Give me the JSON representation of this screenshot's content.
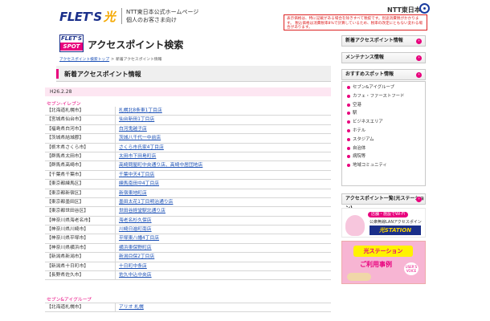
{
  "header": {
    "logo_text": "FLET'S",
    "logo_hikari": "光",
    "official_line1": "NTT東日本公式ホームページ",
    "official_line2": "個人のお客さま向け",
    "brand": "NTT東日本",
    "tax_notice": "表示価格は、特に記載がある場合を除きすべて税抜です。別途消費税がかかります。 税込価格は消費税率8%で計算しているため、税率の改定にともない変わる場合があります。"
  },
  "page": {
    "spot_logo_top": "FLET'S",
    "spot_logo_bottom": "SPOT",
    "title": "アクセスポイント検索",
    "breadcrumb": {
      "link": "アクセスポイント検索トップ",
      "sep": ">",
      "current": "新着アクセスポイント情報"
    }
  },
  "section": {
    "heading": "新着アクセスポイント情報",
    "date": "H26.2.28",
    "group1": "セブン-イレブン",
    "rows": [
      {
        "pref": "【北海道札幌市】",
        "loc": "札幌北8条東1丁目店"
      },
      {
        "pref": "【宮城県仙台市】",
        "loc": "仙台新田1丁目店"
      },
      {
        "pref": "【福島県白河市】",
        "loc": "白河鬼越子店"
      },
      {
        "pref": "【茨城県結城郡】",
        "loc": "茨城八千代一中前店"
      },
      {
        "pref": "【栃木県さくら市】",
        "loc": "さくら市氏家4丁目店"
      },
      {
        "pref": "【群馬県太田市】",
        "loc": "太田市下田島町店"
      },
      {
        "pref": "【群馬県高崎市】",
        "loc": "高崎問屋町中央通り店、高崎中居団地店"
      },
      {
        "pref": "【千葉県千葉市】",
        "loc": "千葉中天4丁目店"
      },
      {
        "pref": "【東京都練馬区】",
        "loc": "練馬南田中4丁目店"
      },
      {
        "pref": "【東京都新宿区】",
        "loc": "新宿東地町店"
      },
      {
        "pref": "【東京都墨田区】",
        "loc": "墨田太花1丁目明治通り店"
      },
      {
        "pref": "【東京都世田谷区】",
        "loc": "世田谷経堂駅北通り店"
      },
      {
        "pref": "【神奈川県海老名市】",
        "loc": "海老名杉久保店"
      },
      {
        "pref": "【神奈川県川崎市】",
        "loc": "川崎日進町南店"
      },
      {
        "pref": "【神奈川県平塚市】",
        "loc": "平塚東八幡4丁目店"
      },
      {
        "pref": "【神奈川県横浜市】",
        "loc": "横浜東保野町店"
      },
      {
        "pref": "【新潟県新潟市】",
        "loc": "新潟目保2丁目店"
      },
      {
        "pref": "【新潟県十日町市】",
        "loc": "十日町中条店"
      },
      {
        "pref": "【長野県佐久市】",
        "loc": "佐久中込中央店"
      }
    ],
    "group2": "セブン&アイグループ",
    "rows2": [
      {
        "pref": "【北海道札幌市】",
        "loc": "アリオ 札幌"
      }
    ]
  },
  "sidebar": {
    "btn_new": "新着アクセスポイント情報",
    "btn_maint": "メンテナンス情報",
    "btn_spots": "おすすめスポット情報",
    "spots": [
      "セブン&アイグループ",
      "カフェ・ファーストフード",
      "空港",
      "駅",
      "ビジネスエリア",
      "ホテル",
      "スタジアム",
      "自治体",
      "病院等",
      "地域コミュニティ"
    ],
    "btn_list": "アクセスポイント一覧(光ステーション)",
    "banner1_tag": "店舗・施設でWi-Fi",
    "banner1_sub": "公衆無線LANアクセスポイント",
    "banner1_big": "光STATION",
    "banner2_title": "光ステーション",
    "banner2_sub": "ご利用事例",
    "banner2_tag": "USER'S VOICE",
    "arrow": "›"
  }
}
